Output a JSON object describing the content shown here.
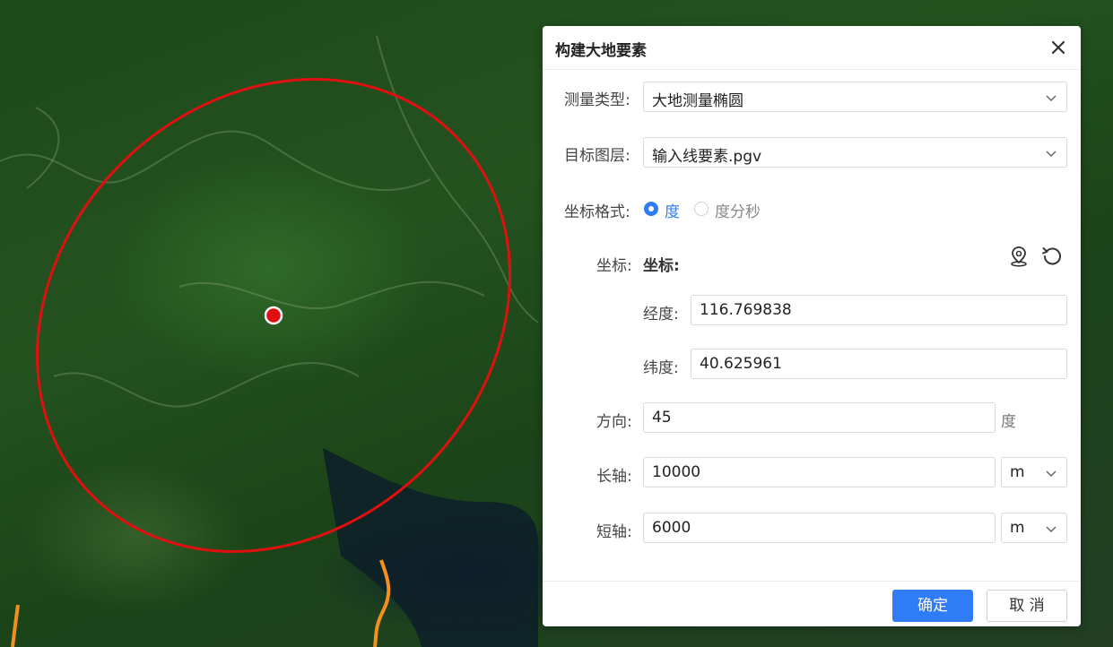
{
  "dialog": {
    "title": "构建大地要素",
    "measure_type": {
      "label": "测量类型:",
      "value": "大地测量椭圆"
    },
    "target_layer": {
      "label": "目标图层:",
      "value": "输入线要素.pgv"
    },
    "coord_format": {
      "label": "坐标格式:",
      "options": [
        {
          "label": "度",
          "selected": true
        },
        {
          "label": "度分秒",
          "selected": false
        }
      ]
    },
    "coord": {
      "label": "坐标:",
      "sub_label": "坐标:",
      "longitude": {
        "label": "经度:",
        "value": "116.769838"
      },
      "latitude": {
        "label": "纬度:",
        "value": "40.625961"
      }
    },
    "direction": {
      "label": "方向:",
      "value": "45",
      "unit": "度"
    },
    "major_axis": {
      "label": "长轴:",
      "value": "10000",
      "unit": "m"
    },
    "minor_axis": {
      "label": "短轴:",
      "value": "6000",
      "unit": "m"
    },
    "buttons": {
      "ok": "确定",
      "cancel": "取 消"
    }
  },
  "icons": [
    "close-icon",
    "map-pin-icon",
    "reset-icon",
    "chevron-down-icon"
  ],
  "colors": {
    "accent": "#2f7cf6",
    "ellipse": "#e01010",
    "route": "#f5901e"
  }
}
